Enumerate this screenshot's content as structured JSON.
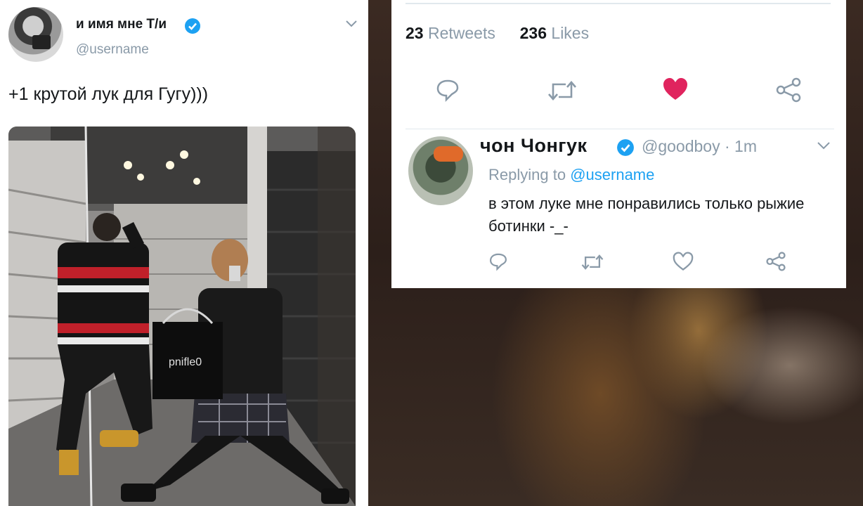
{
  "left_tweet": {
    "author_name": "и имя мне Т/и",
    "handle": "@username",
    "text": "+1 крутой лук для Гугу)))",
    "photo": {
      "bag_text": "pnifle0"
    }
  },
  "right_tweet": {
    "retweets_count": "23",
    "retweets_label": "Retweets",
    "likes_count": "236",
    "likes_label": "Likes",
    "actions": [
      "reply-icon",
      "retweet-icon",
      "heart-filled-icon",
      "share-icon"
    ],
    "like_color": "#e0245e"
  },
  "reply": {
    "author_name": "чон  Чонгук",
    "handle": "@goodboy",
    "time": "· 1m",
    "replying_prefix": "Replying to",
    "replying_to": "@username",
    "text": "в этом луке мне понравились только рыжие ботинки -_-"
  },
  "colors": {
    "verified": "#1da1f2",
    "link": "#1da1f2",
    "muted": "#8a9aa8"
  }
}
